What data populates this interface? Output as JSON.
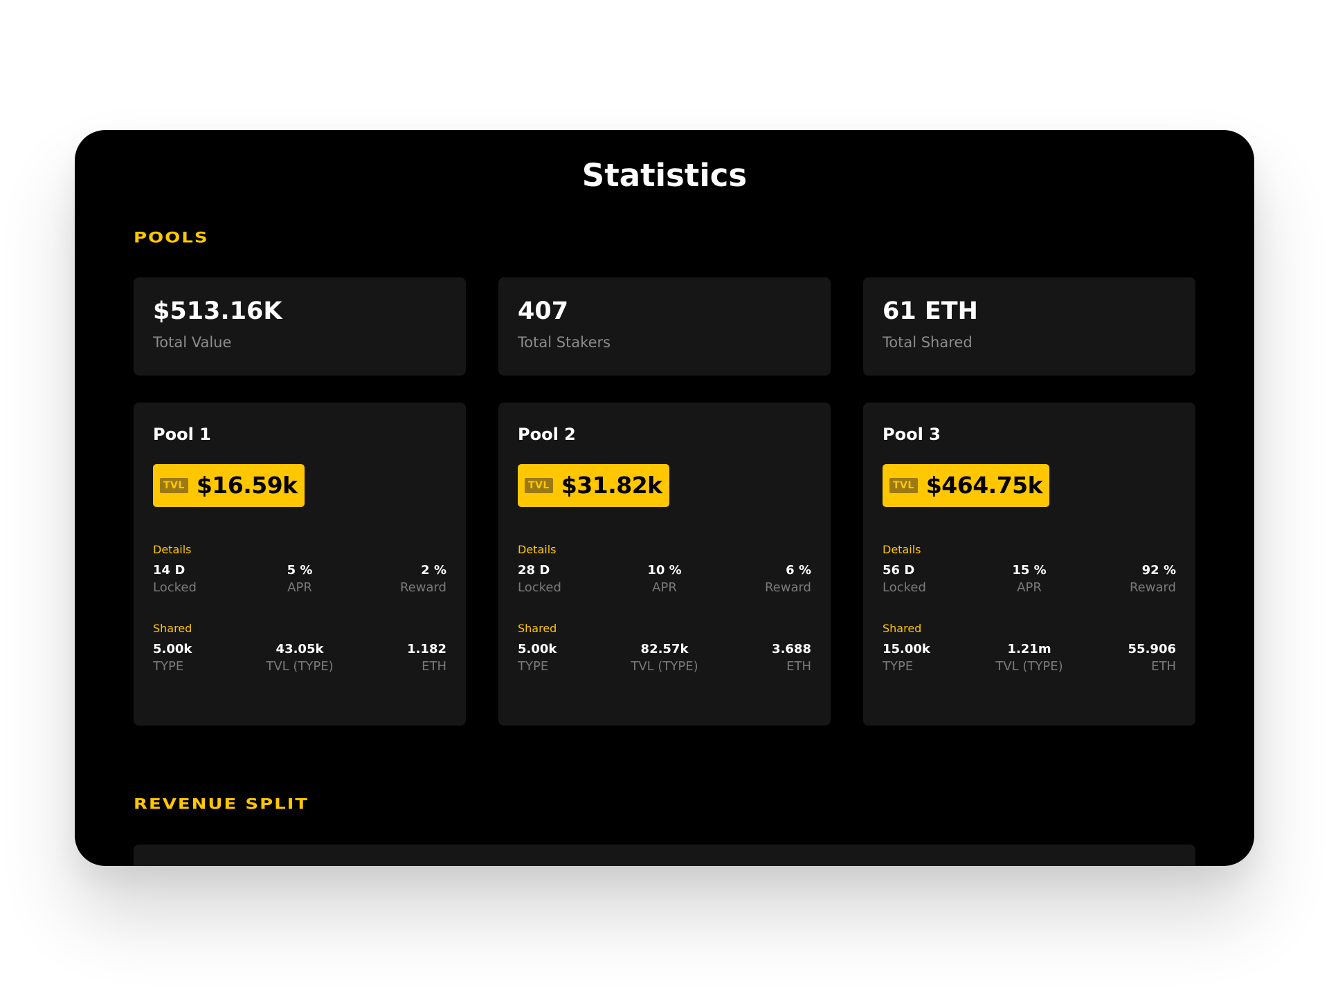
{
  "page": {
    "title": "Statistics"
  },
  "sections": {
    "pools_title": "POOLS",
    "revenue_title": "REVENUE SPLIT"
  },
  "summary": [
    {
      "value": "$513.16K",
      "label": "Total Value"
    },
    {
      "value": "407",
      "label": "Total Stakers"
    },
    {
      "value": "61 ETH",
      "label": "Total Shared"
    }
  ],
  "pools": [
    {
      "name": "Pool 1",
      "tvl_tag": "TVL",
      "tvl": "$16.59k",
      "details_label": "Details",
      "details": [
        {
          "value": "14 D",
          "label": "Locked"
        },
        {
          "value": "5 %",
          "label": "APR"
        },
        {
          "value": "2 %",
          "label": "Reward"
        }
      ],
      "shared_label": "Shared",
      "shared": [
        {
          "value": "5.00k",
          "label": "TYPE"
        },
        {
          "value": "43.05k",
          "label": "TVL (TYPE)"
        },
        {
          "value": "1.182",
          "label": "ETH"
        }
      ]
    },
    {
      "name": "Pool 2",
      "tvl_tag": "TVL",
      "tvl": "$31.82k",
      "details_label": "Details",
      "details": [
        {
          "value": "28 D",
          "label": "Locked"
        },
        {
          "value": "10 %",
          "label": "APR"
        },
        {
          "value": "6 %",
          "label": "Reward"
        }
      ],
      "shared_label": "Shared",
      "shared": [
        {
          "value": "5.00k",
          "label": "TYPE"
        },
        {
          "value": "82.57k",
          "label": "TVL (TYPE)"
        },
        {
          "value": "3.688",
          "label": "ETH"
        }
      ]
    },
    {
      "name": "Pool 3",
      "tvl_tag": "TVL",
      "tvl": "$464.75k",
      "details_label": "Details",
      "details": [
        {
          "value": "56 D",
          "label": "Locked"
        },
        {
          "value": "15 %",
          "label": "APR"
        },
        {
          "value": "92 %",
          "label": "Reward"
        }
      ],
      "shared_label": "Shared",
      "shared": [
        {
          "value": "15.00k",
          "label": "TYPE"
        },
        {
          "value": "1.21m",
          "label": "TVL (TYPE)"
        },
        {
          "value": "55.906",
          "label": "ETH"
        }
      ]
    }
  ],
  "colors": {
    "accent": "#ffc700",
    "panel": "#000000",
    "card": "#161616",
    "muted_text": "#8c8c8c"
  }
}
